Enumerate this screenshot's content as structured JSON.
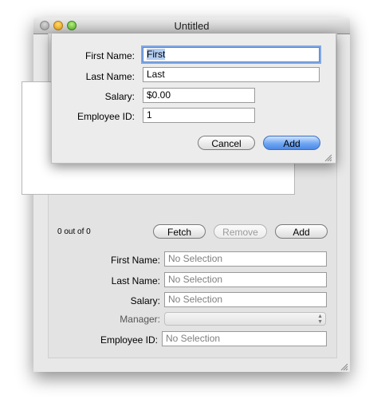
{
  "window": {
    "title": "Untitled"
  },
  "main": {
    "record_count": "0 out of 0",
    "buttons": {
      "fetch": "Fetch",
      "remove": "Remove",
      "add": "Add"
    },
    "form": {
      "first_name_label": "First Name:",
      "last_name_label": "Last Name:",
      "salary_label": "Salary:",
      "manager_label": "Manager:",
      "employee_id_label": "Employee ID:",
      "first_name_value": "No Selection",
      "last_name_value": "No Selection",
      "salary_value": "No Selection",
      "manager_value": "",
      "employee_id_value": "No Selection"
    }
  },
  "sheet": {
    "first_name_label": "First Name:",
    "last_name_label": "Last Name:",
    "salary_label": "Salary:",
    "employee_id_label": "Employee ID:",
    "first_name_value": "First",
    "last_name_value": "Last",
    "salary_value": "$0.00",
    "employee_id_value": "1",
    "cancel_label": "Cancel",
    "add_label": "Add"
  }
}
